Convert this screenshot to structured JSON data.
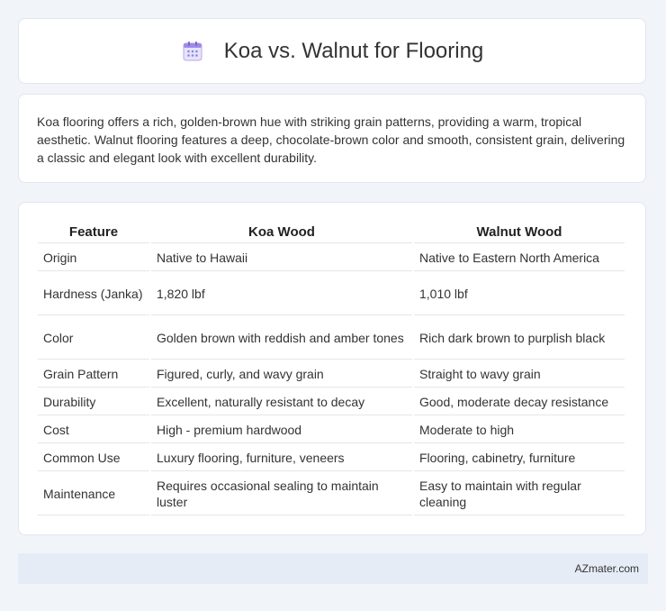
{
  "header": {
    "title": "Koa vs. Walnut for Flooring",
    "icon": "calendar-icon"
  },
  "intro": {
    "text": "Koa flooring offers a rich, golden-brown hue with striking grain patterns, providing a warm, tropical aesthetic. Walnut flooring features a deep, chocolate-brown color and smooth, consistent grain, delivering a classic and elegant look with excellent durability."
  },
  "table": {
    "headers": [
      "Feature",
      "Koa Wood",
      "Walnut Wood"
    ],
    "rows": [
      [
        "Origin",
        "Native to Hawaii",
        "Native to Eastern North America"
      ],
      [
        "Hardness (Janka)",
        "1,820 lbf",
        "1,010 lbf"
      ],
      [
        "Color",
        "Golden brown with reddish and amber tones",
        "Rich dark brown to purplish black"
      ],
      [
        "Grain Pattern",
        "Figured, curly, and wavy grain",
        "Straight to wavy grain"
      ],
      [
        "Durability",
        "Excellent, naturally resistant to decay",
        "Good, moderate decay resistance"
      ],
      [
        "Cost",
        "High - premium hardwood",
        "Moderate to high"
      ],
      [
        "Common Use",
        "Luxury flooring, furniture, veneers",
        "Flooring, cabinetry, furniture"
      ],
      [
        "Maintenance",
        "Requires occasional sealing to maintain luster",
        "Easy to maintain with regular cleaning"
      ]
    ]
  },
  "footer": {
    "text": "AZmater.com"
  }
}
